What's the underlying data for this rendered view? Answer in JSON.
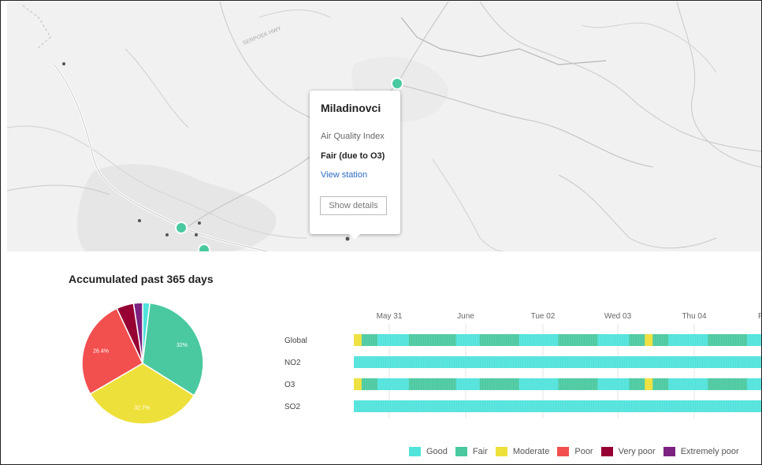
{
  "map": {
    "road_label": "SERPOEK HWY",
    "popup": {
      "station_name": "Miladinovci",
      "aqi_label": "Air Quality Index",
      "aqi_value": "Fair (due to O3)",
      "view_link": "View station",
      "details_button": "Show details"
    }
  },
  "accumulated": {
    "title": "Accumulated past 365 days"
  },
  "colors": {
    "good": "#50e3dc",
    "fair": "#4ac9a0",
    "moderate": "#eee03a",
    "poor": "#f24f4f",
    "very_poor": "#960032",
    "extremely_poor": "#7d2181"
  },
  "chart_data": [
    {
      "type": "pie",
      "title": "Accumulated past 365 days",
      "slices": [
        {
          "category": "Good",
          "value": 1.9,
          "label": "",
          "color": "#50e3dc"
        },
        {
          "category": "Fair",
          "value": 32,
          "label": "32%",
          "color": "#4ac9a0"
        },
        {
          "category": "Moderate",
          "value": 32.7,
          "label": "32.7%",
          "color": "#eee03a"
        },
        {
          "category": "Poor",
          "value": 26.4,
          "label": "26.4%",
          "color": "#f24f4f"
        },
        {
          "category": "Very poor",
          "value": 4.6,
          "label": "",
          "color": "#960032"
        },
        {
          "category": "Extremely poor",
          "value": 2.4,
          "label": "",
          "color": "#7d2181"
        }
      ]
    },
    {
      "type": "heatmap",
      "x_ticks": [
        "May 31",
        "June",
        "Tue 02",
        "Wed 03",
        "Thu 04",
        "F"
      ],
      "rows": [
        {
          "name": "Global",
          "values": [
            "moderate",
            "fair",
            "fair",
            "good",
            "good",
            "good",
            "good",
            "fair",
            "fair",
            "fair",
            "fair",
            "fair",
            "fair",
            "good",
            "good",
            "good",
            "fair",
            "fair",
            "fair",
            "fair",
            "fair",
            "good",
            "good",
            "good",
            "good",
            "good",
            "fair",
            "fair",
            "fair",
            "fair",
            "fair",
            "good",
            "good",
            "good",
            "good",
            "fair",
            "fair",
            "moderate",
            "fair",
            "fair",
            "good",
            "good",
            "good",
            "good",
            "good",
            "fair",
            "fair",
            "fair",
            "fair",
            "fair",
            "good",
            "good"
          ]
        },
        {
          "name": "NO2",
          "values": [
            "good",
            "good",
            "good",
            "good",
            "good",
            "good",
            "good",
            "good",
            "good",
            "good",
            "good",
            "good",
            "good",
            "good",
            "good",
            "good",
            "good",
            "good",
            "good",
            "good",
            "good",
            "good",
            "good",
            "good",
            "good",
            "good",
            "good",
            "good",
            "good",
            "good",
            "good",
            "good",
            "good",
            "good",
            "good",
            "good",
            "good",
            "good",
            "good",
            "good",
            "good",
            "good",
            "good",
            "good",
            "good",
            "good",
            "good",
            "good",
            "good",
            "good",
            "good",
            "good"
          ]
        },
        {
          "name": "O3",
          "values": [
            "moderate",
            "fair",
            "fair",
            "good",
            "good",
            "good",
            "good",
            "fair",
            "fair",
            "fair",
            "fair",
            "fair",
            "fair",
            "good",
            "good",
            "good",
            "fair",
            "fair",
            "fair",
            "fair",
            "fair",
            "good",
            "good",
            "good",
            "good",
            "good",
            "fair",
            "fair",
            "fair",
            "fair",
            "fair",
            "good",
            "good",
            "good",
            "good",
            "fair",
            "fair",
            "moderate",
            "fair",
            "fair",
            "good",
            "good",
            "good",
            "good",
            "good",
            "fair",
            "fair",
            "fair",
            "fair",
            "fair",
            "good",
            "good"
          ]
        },
        {
          "name": "SO2",
          "values": [
            "good",
            "good",
            "good",
            "good",
            "good",
            "good",
            "good",
            "good",
            "good",
            "good",
            "good",
            "good",
            "good",
            "good",
            "good",
            "good",
            "good",
            "good",
            "good",
            "good",
            "good",
            "good",
            "good",
            "good",
            "good",
            "good",
            "good",
            "good",
            "good",
            "good",
            "good",
            "good",
            "good",
            "good",
            "good",
            "good",
            "good",
            "good",
            "good",
            "good",
            "good",
            "good",
            "good",
            "good",
            "good",
            "good",
            "good",
            "good",
            "good",
            "good",
            "good",
            "good"
          ]
        }
      ]
    }
  ],
  "legend": [
    {
      "label": "Good",
      "color": "#50e3dc"
    },
    {
      "label": "Fair",
      "color": "#4ac9a0"
    },
    {
      "label": "Moderate",
      "color": "#eee03a"
    },
    {
      "label": "Poor",
      "color": "#f24f4f"
    },
    {
      "label": "Very poor",
      "color": "#960032"
    },
    {
      "label": "Extremely poor",
      "color": "#7d2181"
    }
  ]
}
